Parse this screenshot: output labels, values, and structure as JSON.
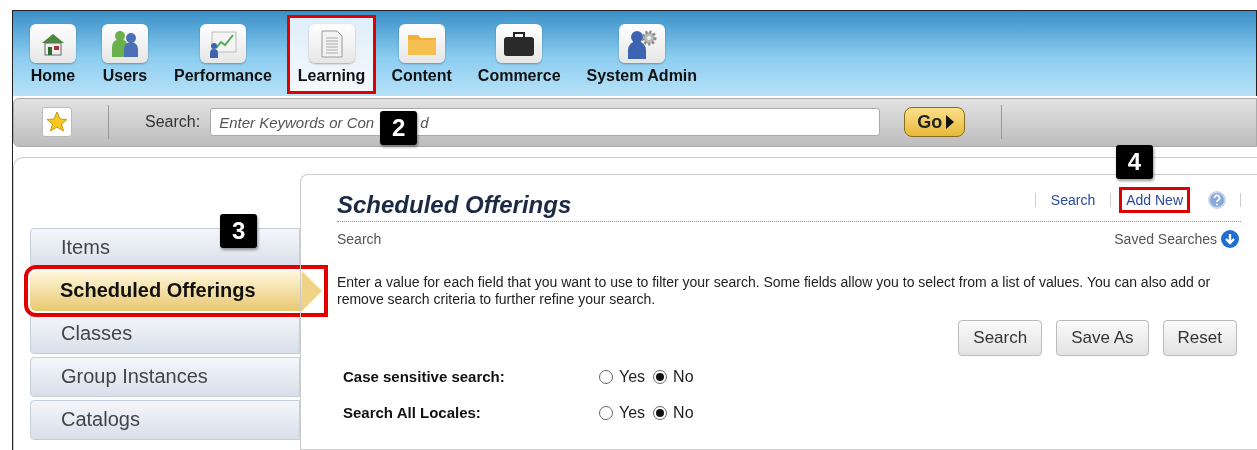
{
  "nav": {
    "items": [
      {
        "label": "Home",
        "kind": "home",
        "selected": false,
        "highlighted": false
      },
      {
        "label": "Users",
        "kind": "users",
        "selected": false,
        "highlighted": false
      },
      {
        "label": "Performance",
        "kind": "chart",
        "selected": false,
        "highlighted": false
      },
      {
        "label": "Learning",
        "kind": "document",
        "selected": true,
        "highlighted": true
      },
      {
        "label": "Content",
        "kind": "folder",
        "selected": false,
        "highlighted": false
      },
      {
        "label": "Commerce",
        "kind": "briefcase",
        "selected": false,
        "highlighted": false
      },
      {
        "label": "System Admin",
        "kind": "admin",
        "selected": false,
        "highlighted": false
      }
    ]
  },
  "toolbar": {
    "search_label": "Search:",
    "placeholder_start": "Enter Keywords or Con",
    "callout": "2",
    "placeholder_end": "d",
    "go_button": "Go"
  },
  "sidebar": {
    "callout": "3",
    "items": [
      {
        "label": "Items",
        "selected": false,
        "highlighted": false
      },
      {
        "label": "Scheduled Offerings",
        "selected": true,
        "highlighted": true
      },
      {
        "label": "Classes",
        "selected": false,
        "highlighted": false
      },
      {
        "label": "Group Instances",
        "selected": false,
        "highlighted": false
      },
      {
        "label": "Catalogs",
        "selected": false,
        "highlighted": false
      }
    ]
  },
  "panel": {
    "title": "Scheduled Offerings",
    "callout": "4",
    "links": [
      {
        "label": "Search",
        "highlighted": false
      },
      {
        "label": "Add New",
        "highlighted": true
      }
    ],
    "section": "Search",
    "saved_searches": "Saved Searches",
    "instructions": "Enter a value for each field that you want to use to filter your search. Some fields allow you to select from a list of values. You can also add or remove search criteria to further refine your search.",
    "buttons": [
      "Search",
      "Save As",
      "Reset"
    ],
    "fields": [
      {
        "label": "Case sensitive search:",
        "options": [
          {
            "label": "Yes",
            "selected": false
          },
          {
            "label": "No",
            "selected": true
          }
        ]
      },
      {
        "label": "Search All Locales:",
        "options": [
          {
            "label": "Yes",
            "selected": false
          },
          {
            "label": "No",
            "selected": true
          }
        ]
      }
    ]
  }
}
